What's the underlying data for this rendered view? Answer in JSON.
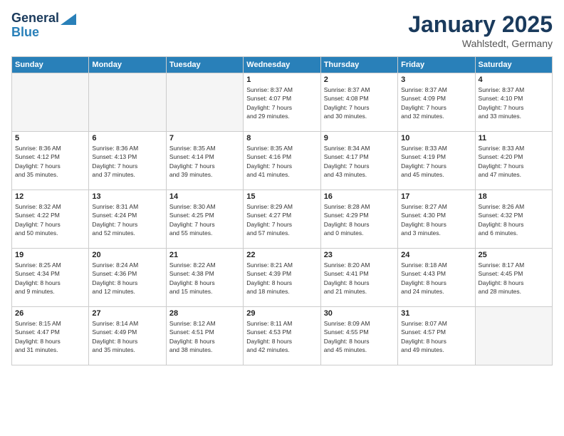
{
  "header": {
    "logo_line1": "General",
    "logo_line2": "Blue",
    "month": "January 2025",
    "location": "Wahlstedt, Germany"
  },
  "weekdays": [
    "Sunday",
    "Monday",
    "Tuesday",
    "Wednesday",
    "Thursday",
    "Friday",
    "Saturday"
  ],
  "weeks": [
    [
      {
        "day": "",
        "info": ""
      },
      {
        "day": "",
        "info": ""
      },
      {
        "day": "",
        "info": ""
      },
      {
        "day": "1",
        "info": "Sunrise: 8:37 AM\nSunset: 4:07 PM\nDaylight: 7 hours\nand 29 minutes."
      },
      {
        "day": "2",
        "info": "Sunrise: 8:37 AM\nSunset: 4:08 PM\nDaylight: 7 hours\nand 30 minutes."
      },
      {
        "day": "3",
        "info": "Sunrise: 8:37 AM\nSunset: 4:09 PM\nDaylight: 7 hours\nand 32 minutes."
      },
      {
        "day": "4",
        "info": "Sunrise: 8:37 AM\nSunset: 4:10 PM\nDaylight: 7 hours\nand 33 minutes."
      }
    ],
    [
      {
        "day": "5",
        "info": "Sunrise: 8:36 AM\nSunset: 4:12 PM\nDaylight: 7 hours\nand 35 minutes."
      },
      {
        "day": "6",
        "info": "Sunrise: 8:36 AM\nSunset: 4:13 PM\nDaylight: 7 hours\nand 37 minutes."
      },
      {
        "day": "7",
        "info": "Sunrise: 8:35 AM\nSunset: 4:14 PM\nDaylight: 7 hours\nand 39 minutes."
      },
      {
        "day": "8",
        "info": "Sunrise: 8:35 AM\nSunset: 4:16 PM\nDaylight: 7 hours\nand 41 minutes."
      },
      {
        "day": "9",
        "info": "Sunrise: 8:34 AM\nSunset: 4:17 PM\nDaylight: 7 hours\nand 43 minutes."
      },
      {
        "day": "10",
        "info": "Sunrise: 8:33 AM\nSunset: 4:19 PM\nDaylight: 7 hours\nand 45 minutes."
      },
      {
        "day": "11",
        "info": "Sunrise: 8:33 AM\nSunset: 4:20 PM\nDaylight: 7 hours\nand 47 minutes."
      }
    ],
    [
      {
        "day": "12",
        "info": "Sunrise: 8:32 AM\nSunset: 4:22 PM\nDaylight: 7 hours\nand 50 minutes."
      },
      {
        "day": "13",
        "info": "Sunrise: 8:31 AM\nSunset: 4:24 PM\nDaylight: 7 hours\nand 52 minutes."
      },
      {
        "day": "14",
        "info": "Sunrise: 8:30 AM\nSunset: 4:25 PM\nDaylight: 7 hours\nand 55 minutes."
      },
      {
        "day": "15",
        "info": "Sunrise: 8:29 AM\nSunset: 4:27 PM\nDaylight: 7 hours\nand 57 minutes."
      },
      {
        "day": "16",
        "info": "Sunrise: 8:28 AM\nSunset: 4:29 PM\nDaylight: 8 hours\nand 0 minutes."
      },
      {
        "day": "17",
        "info": "Sunrise: 8:27 AM\nSunset: 4:30 PM\nDaylight: 8 hours\nand 3 minutes."
      },
      {
        "day": "18",
        "info": "Sunrise: 8:26 AM\nSunset: 4:32 PM\nDaylight: 8 hours\nand 6 minutes."
      }
    ],
    [
      {
        "day": "19",
        "info": "Sunrise: 8:25 AM\nSunset: 4:34 PM\nDaylight: 8 hours\nand 9 minutes."
      },
      {
        "day": "20",
        "info": "Sunrise: 8:24 AM\nSunset: 4:36 PM\nDaylight: 8 hours\nand 12 minutes."
      },
      {
        "day": "21",
        "info": "Sunrise: 8:22 AM\nSunset: 4:38 PM\nDaylight: 8 hours\nand 15 minutes."
      },
      {
        "day": "22",
        "info": "Sunrise: 8:21 AM\nSunset: 4:39 PM\nDaylight: 8 hours\nand 18 minutes."
      },
      {
        "day": "23",
        "info": "Sunrise: 8:20 AM\nSunset: 4:41 PM\nDaylight: 8 hours\nand 21 minutes."
      },
      {
        "day": "24",
        "info": "Sunrise: 8:18 AM\nSunset: 4:43 PM\nDaylight: 8 hours\nand 24 minutes."
      },
      {
        "day": "25",
        "info": "Sunrise: 8:17 AM\nSunset: 4:45 PM\nDaylight: 8 hours\nand 28 minutes."
      }
    ],
    [
      {
        "day": "26",
        "info": "Sunrise: 8:15 AM\nSunset: 4:47 PM\nDaylight: 8 hours\nand 31 minutes."
      },
      {
        "day": "27",
        "info": "Sunrise: 8:14 AM\nSunset: 4:49 PM\nDaylight: 8 hours\nand 35 minutes."
      },
      {
        "day": "28",
        "info": "Sunrise: 8:12 AM\nSunset: 4:51 PM\nDaylight: 8 hours\nand 38 minutes."
      },
      {
        "day": "29",
        "info": "Sunrise: 8:11 AM\nSunset: 4:53 PM\nDaylight: 8 hours\nand 42 minutes."
      },
      {
        "day": "30",
        "info": "Sunrise: 8:09 AM\nSunset: 4:55 PM\nDaylight: 8 hours\nand 45 minutes."
      },
      {
        "day": "31",
        "info": "Sunrise: 8:07 AM\nSunset: 4:57 PM\nDaylight: 8 hours\nand 49 minutes."
      },
      {
        "day": "",
        "info": ""
      }
    ]
  ]
}
